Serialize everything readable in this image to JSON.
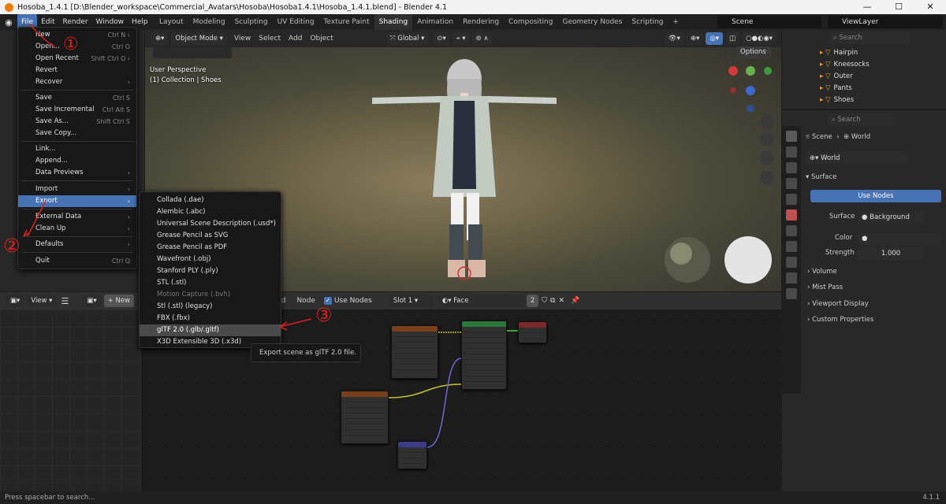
{
  "window": {
    "title": "Hosoba_1.4.1 [D:\\Blender_workspace\\Commercial_Avatars\\Hosoba\\Hosoba1.4.1\\Hosoba_1.4.1.blend] - Blender 4.1",
    "minimize": "—",
    "maximize": "☐",
    "close": "✕"
  },
  "topbar": {
    "menus": [
      "File",
      "Edit",
      "Render",
      "Window",
      "Help"
    ],
    "workspaces": [
      "Layout",
      "Modeling",
      "Sculpting",
      "UV Editing",
      "Texture Paint",
      "Shading",
      "Animation",
      "Rendering",
      "Compositing",
      "Geometry Nodes",
      "Scripting"
    ],
    "active_workspace": "Shading",
    "add_workspace": "+",
    "scene": "Scene",
    "view_layer": "ViewLayer"
  },
  "viewport": {
    "mode": "Object Mode",
    "menus": [
      "View",
      "Select",
      "Add",
      "Object"
    ],
    "orientation": "Global",
    "options": "Options",
    "perspective": "User Perspective",
    "collection": "(1) Collection | Shoes"
  },
  "file_menu": {
    "items": [
      {
        "label": "New",
        "shortcut": "Ctrl N",
        "submenu": true
      },
      {
        "label": "Open...",
        "shortcut": "Ctrl O"
      },
      {
        "label": "Open Recent",
        "shortcut": "Shift Ctrl O",
        "submenu": true
      },
      {
        "label": "Revert",
        "shortcut": ""
      },
      {
        "label": "Recover",
        "shortcut": "",
        "submenu": true
      },
      {
        "label": "Save",
        "shortcut": "Ctrl S"
      },
      {
        "label": "Save Incremental",
        "shortcut": "Ctrl Alt S"
      },
      {
        "label": "Save As...",
        "shortcut": "Shift Ctrl S"
      },
      {
        "label": "Save Copy...",
        "shortcut": ""
      },
      {
        "label": "Link...",
        "shortcut": ""
      },
      {
        "label": "Append...",
        "shortcut": ""
      },
      {
        "label": "Data Previews",
        "shortcut": "",
        "submenu": true
      },
      {
        "label": "Import",
        "shortcut": "",
        "submenu": true
      },
      {
        "label": "Export",
        "shortcut": "",
        "submenu": true
      },
      {
        "label": "External Data",
        "shortcut": "",
        "submenu": true
      },
      {
        "label": "Clean Up",
        "shortcut": "",
        "submenu": true
      },
      {
        "label": "Defaults",
        "shortcut": "",
        "submenu": true
      },
      {
        "label": "Quit",
        "shortcut": "Ctrl Q"
      }
    ]
  },
  "export_menu": {
    "items": [
      "Collada (.dae)",
      "Alembic (.abc)",
      "Universal Scene Description (.usd*)",
      "Grease Pencil as SVG",
      "Grease Pencil as PDF",
      "Wavefront (.obj)",
      "Stanford PLY (.ply)",
      "STL (.stl)",
      "Motion Capture (.bvh)",
      "Stl (.stl) (legacy)",
      "FBX (.fbx)",
      "glTF 2.0 (.glb/.gltf)",
      "X3D Extensible 3D (.x3d)"
    ],
    "tooltip": "Export scene as glTF 2.0 file."
  },
  "node_editor": {
    "menus": [
      "Add",
      "Node"
    ],
    "use_nodes": "Use Nodes",
    "slot": "Slot 1",
    "material": "Face",
    "users": "2",
    "left_view": "View",
    "left_new": "New"
  },
  "outliner": {
    "search_placeholder": "Search",
    "items": [
      "Hairpin",
      "Kneesocks",
      "Outer",
      "Pants",
      "Shoes"
    ]
  },
  "properties": {
    "search_placeholder": "Search",
    "breadcrumb_scene": "Scene",
    "breadcrumb_world": "World",
    "world_name": "World",
    "surface_panel": "Surface",
    "use_nodes_btn": "Use Nodes",
    "surface_label": "Surface",
    "surface_value": "Background",
    "color_label": "Color",
    "strength_label": "Strength",
    "strength_value": "1.000",
    "sections": [
      "Volume",
      "Mist Pass",
      "Viewport Display",
      "Custom Properties"
    ]
  },
  "status_bar": {
    "hint": "Press spacebar to search...",
    "version": "4.1.1"
  },
  "annotations": {
    "one": "①",
    "two": "②",
    "three": "③"
  }
}
